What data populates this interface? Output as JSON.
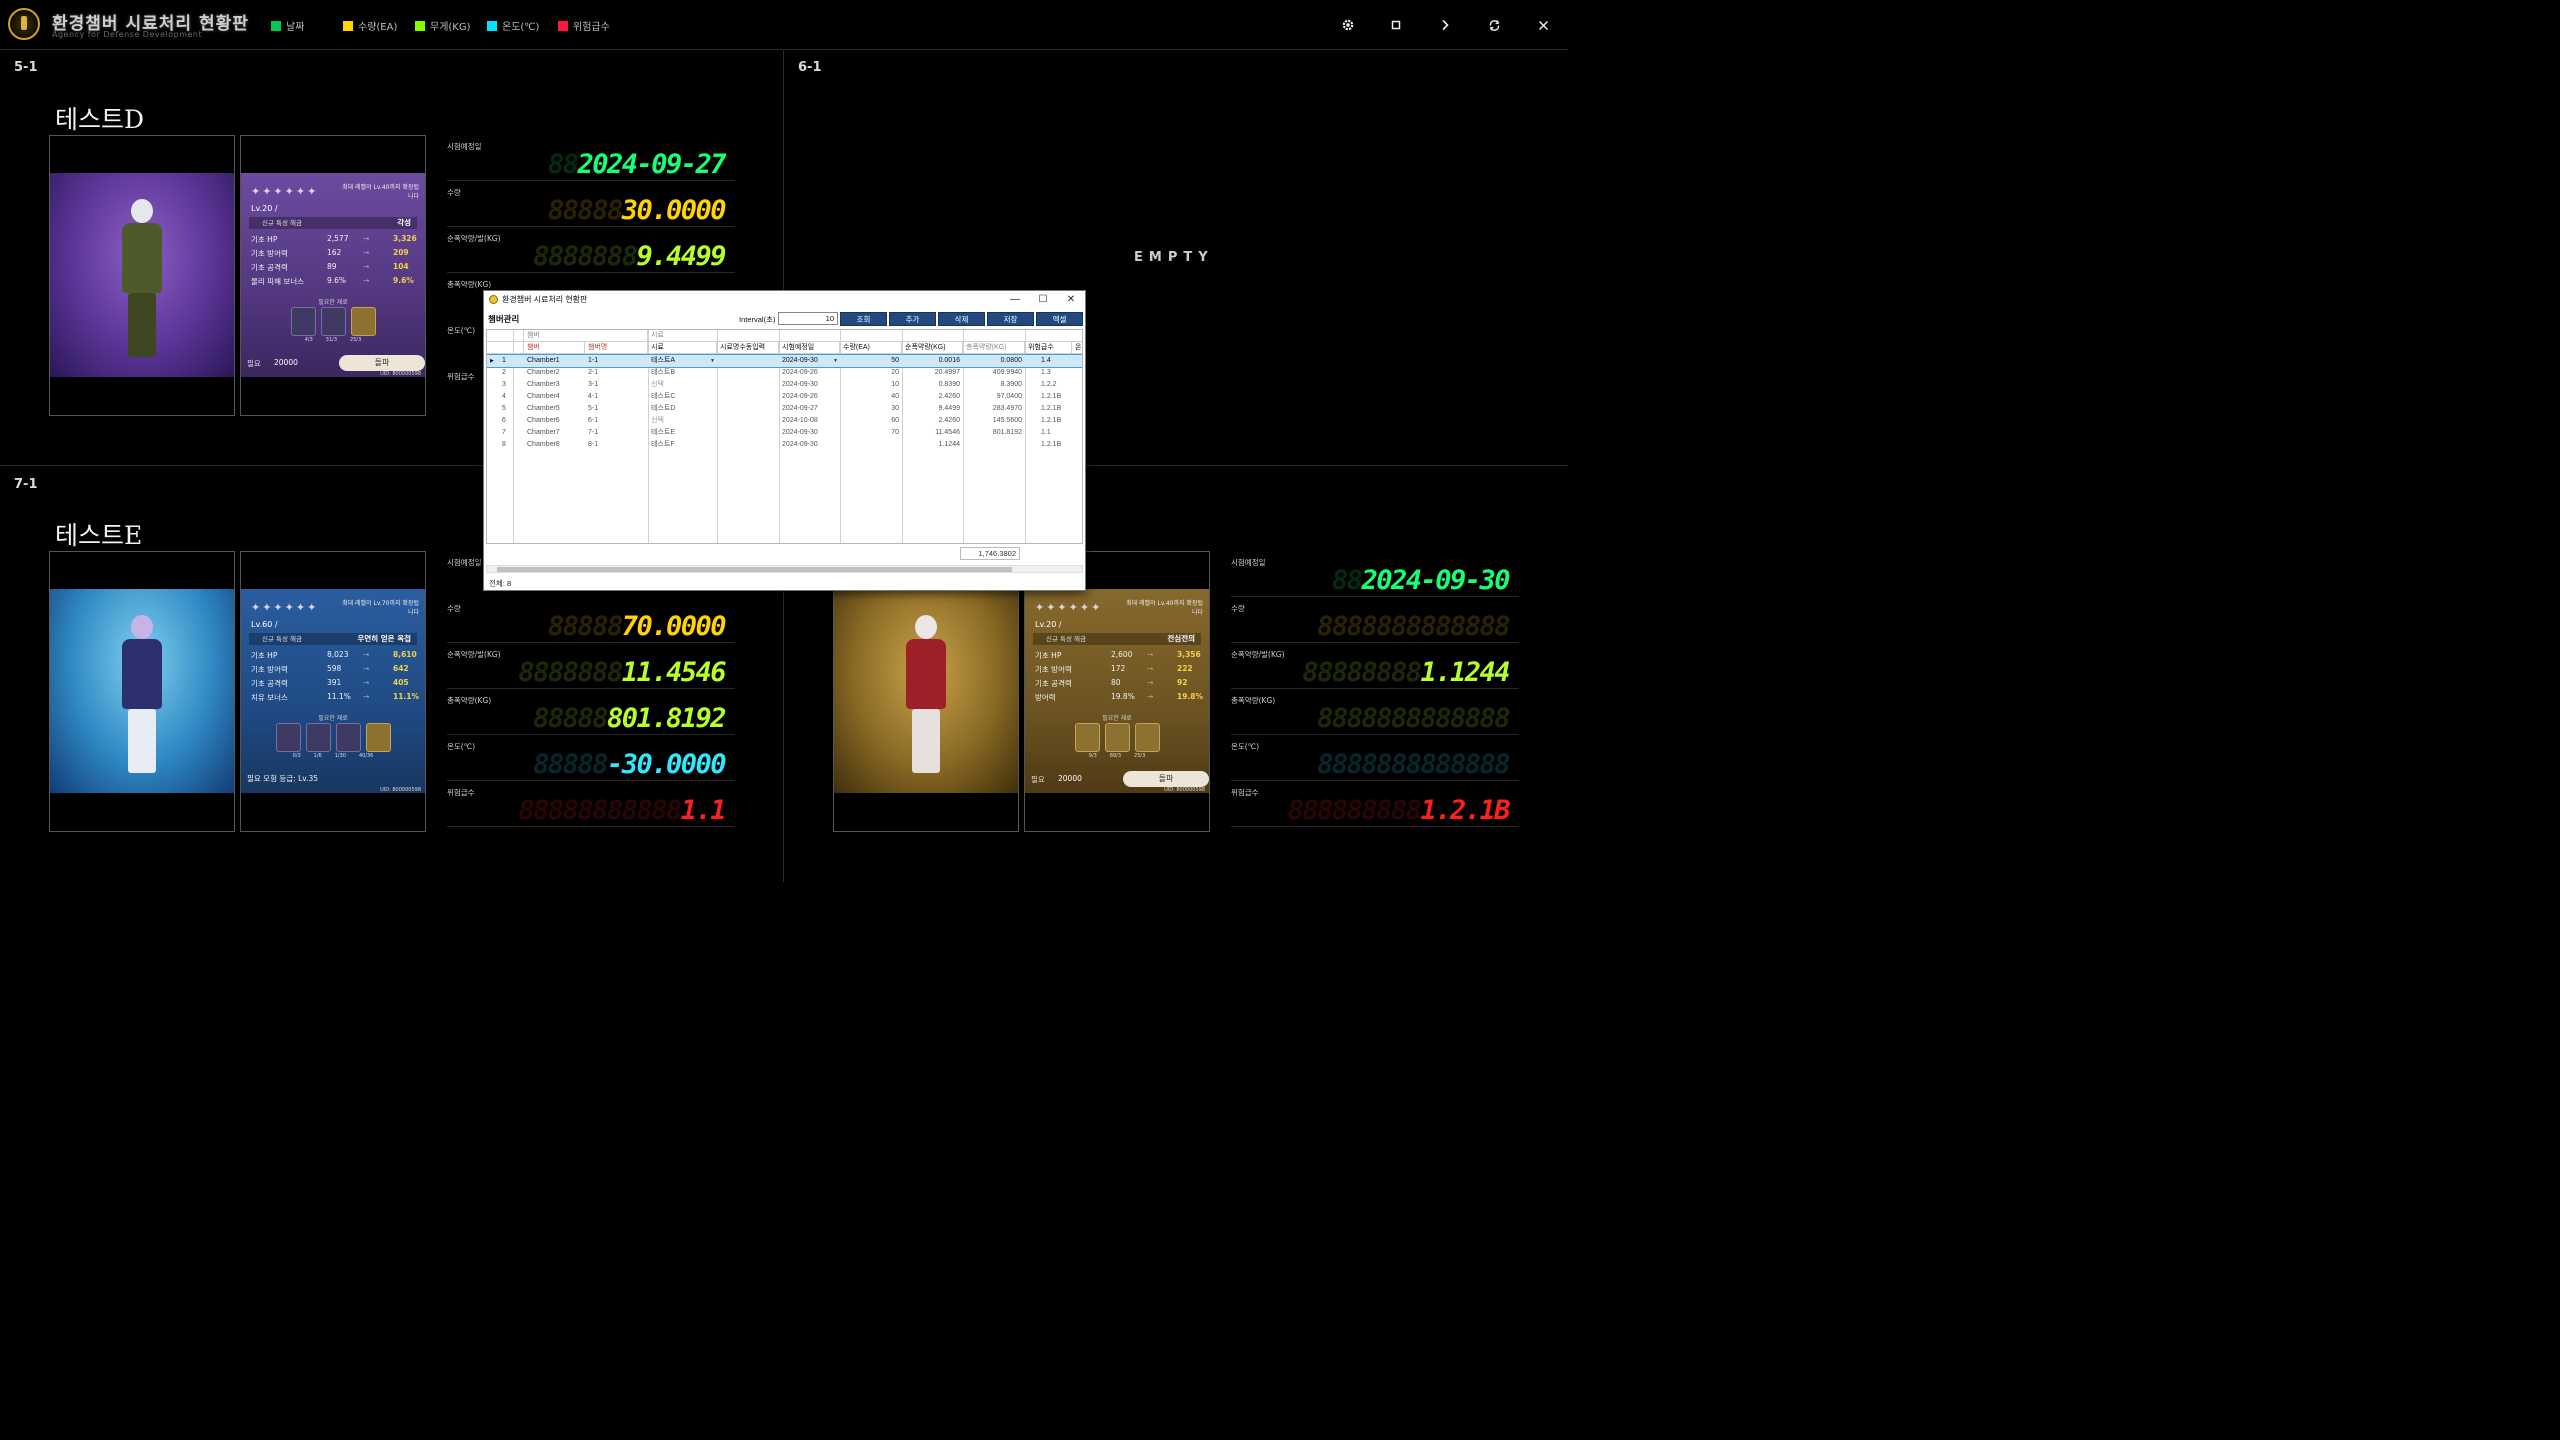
{
  "header": {
    "title": "환경챔버 시료처리 현황판",
    "subtitle": "Agency for Defense Development",
    "legend": [
      {
        "label": "날짜",
        "color": "#00c853"
      },
      {
        "label": "수량(EA)",
        "color": "#ffd600"
      },
      {
        "label": "무게(KG)",
        "color": "#7fff00"
      },
      {
        "label": "온도(℃)",
        "color": "#00e5ff"
      },
      {
        "label": "위험급수",
        "color": "#ff1744"
      }
    ],
    "buttons": [
      "gear-icon",
      "square-icon",
      "chevron-right-icon",
      "refresh-icon",
      "close-icon"
    ]
  },
  "metric_labels": {
    "date": "시험예정일",
    "qty": "수량",
    "net": "순폭약량/발(KG)",
    "total": "총폭약량(KG)",
    "temp": "온도(℃)",
    "risk": "위험급수"
  },
  "colors": {
    "date": "#19ff74",
    "qty": "#ffd400",
    "weight": "#b6ff2a",
    "temp": "#2fe9ff",
    "risk": "#ff1f1f"
  },
  "panels": {
    "p1": {
      "label": "5-1",
      "sample": "테스트D",
      "metrics": {
        "date": {
          "ghost": "88",
          "value": "2024-09-27"
        },
        "qty": {
          "ghost": "88888",
          "value": "30.0000"
        },
        "net": {
          "ghost": "8888888",
          "value": "9.4499"
        }
      },
      "stats": {
        "stars": "✦✦✦✦✦✦",
        "lv_note": "최대 레벨이 Lv.40까지 확장됩니다",
        "lv": "Lv.20 /",
        "skill_label": "신규 특성 해금",
        "skill_value": "각성",
        "rows": [
          {
            "label": "기초 HP",
            "before": "2,577",
            "after": "3,326"
          },
          {
            "label": "기초 방어력",
            "before": "162",
            "after": "209"
          },
          {
            "label": "기초 공격력",
            "before": "89",
            "after": "104"
          },
          {
            "label": "물리 피해 보너스",
            "before": "9.6%",
            "after": "9.6%"
          }
        ],
        "mat_label": "필요한 재료",
        "mat_counts": [
          "4/3",
          "31/3",
          "25/3"
        ],
        "cost_label": "필요",
        "cost_value": "20000",
        "break_label": "돌파",
        "uid": "UID: 800000598"
      }
    },
    "p2": {
      "label": "6-1",
      "empty": "EMPTY"
    },
    "p3": {
      "label": "7-1",
      "sample": "테스트E",
      "metrics": {
        "qty": {
          "ghost": "88888",
          "value": "70.0000"
        },
        "net": {
          "ghost": "8888888",
          "value": "11.4546"
        },
        "total": {
          "ghost": "88888",
          "value": "801.8192"
        },
        "temp": {
          "ghost": "88888",
          "value": "-30.0000"
        },
        "risk": {
          "ghost": "88888888888",
          "value": "1.1"
        }
      },
      "stats": {
        "stars": "✦✦✦✦✦✦",
        "lv_note": "최대 레벨이 Lv.70까지 확장됩니다",
        "lv": "Lv.60 /",
        "skill_label": "신규 특성 해금",
        "skill_value": "우연히 얻은 옥첩",
        "rows": [
          {
            "label": "기초 HP",
            "before": "8,023",
            "after": "8,610"
          },
          {
            "label": "기초 방어력",
            "before": "598",
            "after": "642"
          },
          {
            "label": "기초 공격력",
            "before": "391",
            "after": "405"
          },
          {
            "label": "치유 보너스",
            "before": "11.1%",
            "after": "11.1%"
          }
        ],
        "mat_label": "필요한 재료",
        "mat_counts": [
          "0/3",
          "1/6",
          "1/30",
          "40/36"
        ],
        "req_label": "필요 모험 등급: Lv.35",
        "uid": "UID: 800000598"
      }
    },
    "p4": {
      "metrics": {
        "date": {
          "ghost": "88",
          "value": "2024-09-30"
        },
        "qty": {
          "ghost": "8888888888888",
          "value": ""
        },
        "net": {
          "ghost": "88888888",
          "value": "1.1244"
        },
        "total": {
          "ghost": "8888888888888",
          "value": ""
        },
        "temp": {
          "ghost": "8888888888888",
          "value": ""
        },
        "risk": {
          "ghost": "888888888",
          "value": "1.2.1B"
        }
      },
      "stats": {
        "stars": "✦✦✦✦✦✦",
        "lv_note": "최대 레벨이 Lv.40까지 확장됩니다",
        "lv": "Lv.20 /",
        "skill_label": "신규 특성 해금",
        "skill_value": "전심전의",
        "rows": [
          {
            "label": "기초 HP",
            "before": "2,600",
            "after": "3,356"
          },
          {
            "label": "기초 방어력",
            "before": "172",
            "after": "222"
          },
          {
            "label": "기초 공격력",
            "before": "80",
            "after": "92"
          },
          {
            "label": "방어력",
            "before": "19.8%",
            "after": "19.8%"
          }
        ],
        "mat_label": "필요한 재료",
        "mat_counts": [
          "9/3",
          "88/3",
          "25/3"
        ],
        "cost_label": "필요",
        "cost_value": "20000",
        "break_label": "돌파",
        "uid": "UID: 800000598"
      }
    }
  },
  "dialog": {
    "title": "환경챔버 시료처리 현황판",
    "subtitle": "챔버관리",
    "interval_label": "Interval(초)",
    "interval_value": "10",
    "buttons": [
      "조회",
      "추가",
      "삭제",
      "저장",
      "엑셀"
    ],
    "group_headers": {
      "chamber": "챔버",
      "sample": "시료"
    },
    "columns": [
      "챔버",
      "챔버명",
      "시료",
      "시료명수동입력",
      "시험예정일",
      "수량(EA)",
      "순폭약량(KG)",
      "총폭약량(KG)",
      "위험급수",
      "온"
    ],
    "rows": [
      {
        "no": "1",
        "chamber": "Chamber1",
        "name": "1-1",
        "sample": "테스트A",
        "manual": "",
        "date": "2024-09-30",
        "qty": "50",
        "net": "0.0016",
        "total": "0.0800",
        "risk": "1.4"
      },
      {
        "no": "2",
        "chamber": "Chamber2",
        "name": "2-1",
        "sample": "테스트B",
        "manual": "",
        "date": "2024-09-26",
        "qty": "20",
        "net": "20.4997",
        "total": "409.9940",
        "risk": "1.3"
      },
      {
        "no": "3",
        "chamber": "Chamber3",
        "name": "3-1",
        "sample": "선택",
        "manual": "",
        "date": "2024-09-30",
        "qty": "10",
        "net": "0.8390",
        "total": "8.3900",
        "risk": "1.2.2"
      },
      {
        "no": "4",
        "chamber": "Chamber4",
        "name": "4-1",
        "sample": "테스트C",
        "manual": "",
        "date": "2024-09-26",
        "qty": "40",
        "net": "2.4260",
        "total": "97.0400",
        "risk": "1.2.1B"
      },
      {
        "no": "5",
        "chamber": "Chamber5",
        "name": "5-1",
        "sample": "테스트D",
        "manual": "",
        "date": "2024-09-27",
        "qty": "30",
        "net": "9.4499",
        "total": "283.4970",
        "risk": "1.2.1B"
      },
      {
        "no": "6",
        "chamber": "Chamber6",
        "name": "6-1",
        "sample": "선택",
        "manual": "",
        "date": "2024-10-08",
        "qty": "60",
        "net": "2.4260",
        "total": "145.5600",
        "risk": "1.2.1B"
      },
      {
        "no": "7",
        "chamber": "Chamber7",
        "name": "7-1",
        "sample": "테스트E",
        "manual": "",
        "date": "2024-09-30",
        "qty": "70",
        "net": "11.4546",
        "total": "801.8192",
        "risk": "1.1"
      },
      {
        "no": "8",
        "chamber": "Chamber8",
        "name": "8-1",
        "sample": "테스트F",
        "manual": "",
        "date": "2024-09-30",
        "qty": "",
        "net": "1.1244",
        "total": "",
        "risk": "1.2.1B"
      }
    ],
    "sum": "1,746.3802",
    "footer_label": "전체:",
    "footer_count": "8"
  }
}
